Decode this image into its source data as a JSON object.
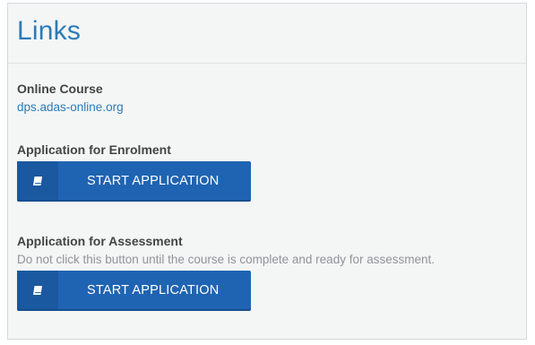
{
  "page": {
    "title": "Links"
  },
  "online_course": {
    "label": "Online Course",
    "link_text": "dps.adas-online.org"
  },
  "enrolment": {
    "label": "Application for Enrolment",
    "button_label": "START APPLICATION",
    "button_icon": "book-icon"
  },
  "assessment": {
    "label": "Application for Assessment",
    "note": "Do not click this button until the course is complete and ready for assessment.",
    "button_label": "START APPLICATION",
    "button_icon": "book-icon"
  },
  "colors": {
    "accent": "#2c7bb6",
    "button": "#1f64b2",
    "button_icon_bg": "#1a58a0",
    "panel_bg": "#f4f5f5"
  }
}
